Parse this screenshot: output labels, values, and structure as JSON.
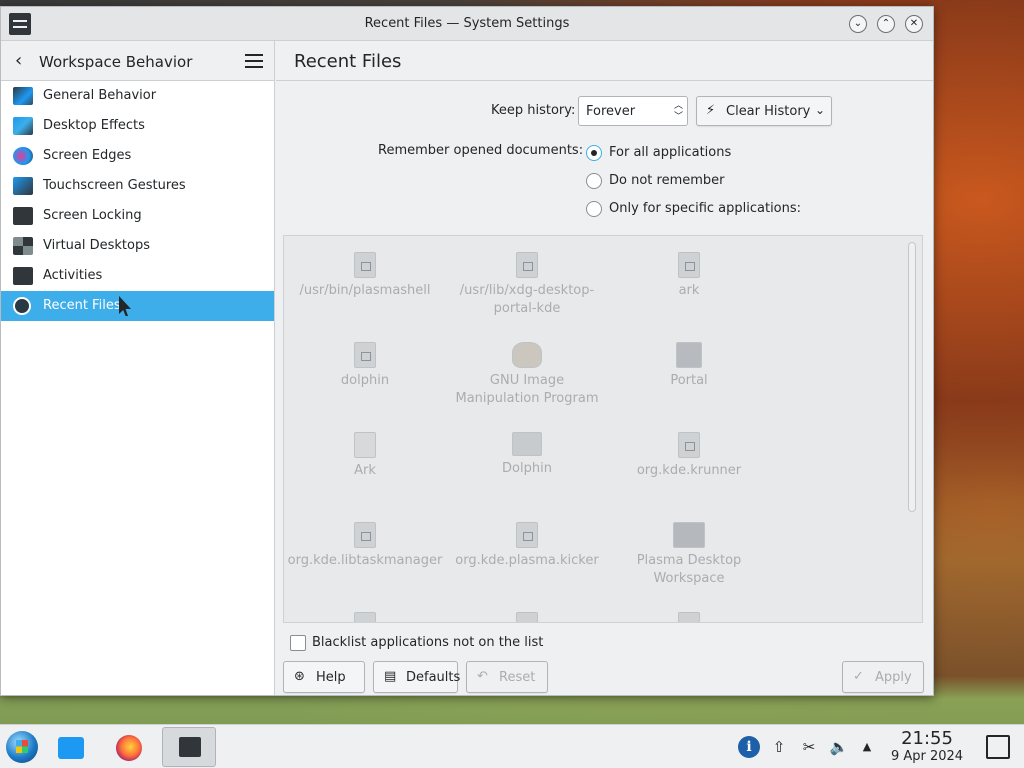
{
  "window": {
    "title": "Recent Files — System Settings",
    "controls": {
      "minimize": "⌄",
      "maximize": "⌃",
      "close": "✕"
    }
  },
  "sidebar": {
    "header": "Workspace Behavior",
    "items": [
      {
        "label": "General Behavior",
        "icon": "general-behavior-icon",
        "active": false
      },
      {
        "label": "Desktop Effects",
        "icon": "desktop-effects-icon",
        "active": false
      },
      {
        "label": "Screen Edges",
        "icon": "screen-edges-icon",
        "active": false
      },
      {
        "label": "Touchscreen Gestures",
        "icon": "touchscreen-gestures-icon",
        "active": false
      },
      {
        "label": "Screen Locking",
        "icon": "screen-locking-icon",
        "active": false
      },
      {
        "label": "Virtual Desktops",
        "icon": "virtual-desktops-icon",
        "active": false
      },
      {
        "label": "Activities",
        "icon": "activities-icon",
        "active": false
      },
      {
        "label": "Recent Files",
        "icon": "recent-files-icon",
        "active": true
      }
    ]
  },
  "main": {
    "title": "Recent Files",
    "keep_history": {
      "label": "Keep history:",
      "value": "Forever"
    },
    "clear_history": {
      "label": "Clear History"
    },
    "remember": {
      "label": "Remember opened documents:",
      "options": [
        {
          "label": "For all applications",
          "checked": true
        },
        {
          "label": "Do not remember",
          "checked": false
        },
        {
          "label": "Only for specific applications:",
          "checked": false
        }
      ]
    },
    "applications": [
      {
        "name": "/usr/bin/plasmashell",
        "icon": "file-icon"
      },
      {
        "name": "/usr/lib/xdg-desktop-portal-kde",
        "icon": "file-icon"
      },
      {
        "name": "ark",
        "icon": "file-icon"
      },
      {
        "name": "dolphin",
        "icon": "file-icon"
      },
      {
        "name": "GNU Image Manipulation Program",
        "icon": "gimp-icon"
      },
      {
        "name": "Portal",
        "icon": "kde-icon"
      },
      {
        "name": "Ark",
        "icon": "archive-icon"
      },
      {
        "name": "Dolphin",
        "icon": "folder-icon"
      },
      {
        "name": "org.kde.krunner",
        "icon": "file-icon"
      },
      {
        "name": "org.kde.libtaskmanager",
        "icon": "file-icon"
      },
      {
        "name": "org.kde.plasma.kicker",
        "icon": "file-icon"
      },
      {
        "name": "Plasma Desktop Workspace",
        "icon": "plasma-icon"
      }
    ],
    "blacklist": {
      "label": "Blacklist applications not on the list",
      "checked": false
    },
    "buttons": {
      "help": "Help",
      "defaults": "Defaults",
      "reset": "Reset",
      "apply": "Apply"
    }
  },
  "taskbar": {
    "clock_time": "21:55",
    "clock_date": "9 Apr 2024",
    "tray": {
      "info": "i",
      "update": "⇧",
      "clipboard": "✂",
      "volume": "🔈",
      "expand": "▲"
    }
  },
  "colors": {
    "accent": "#3daee9",
    "window_bg": "#eff0f1",
    "sidebar_bg": "#ffffff",
    "disabled_text": "#a9adb1"
  }
}
